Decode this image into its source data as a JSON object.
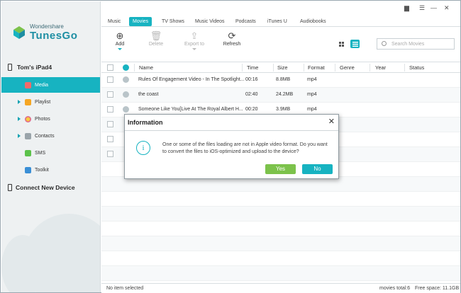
{
  "app": {
    "brand_small": "Wondershare",
    "brand_name": "TunesGo"
  },
  "sidebar": {
    "device": "Tom's iPad4",
    "items": [
      {
        "label": "Media",
        "icon": "music-icon"
      },
      {
        "label": "Playlist",
        "icon": "playlist-icon"
      },
      {
        "label": "Photos",
        "icon": "photos-icon"
      },
      {
        "label": "Contacts",
        "icon": "contacts-icon"
      },
      {
        "label": "SMS",
        "icon": "sms-icon"
      },
      {
        "label": "Toolkit",
        "icon": "toolkit-icon"
      }
    ],
    "connect": "Connect New Device"
  },
  "tabs": [
    "Music",
    "Movies",
    "TV Shows",
    "Music Videos",
    "Podcasts",
    "iTunes U",
    "Audiobooks"
  ],
  "active_tab": "Movies",
  "toolbar": {
    "add": "Add",
    "delete": "Delete",
    "export": "Export to",
    "refresh": "Refresh"
  },
  "search": {
    "placeholder": "Search Movies"
  },
  "table": {
    "headers": {
      "name": "Name",
      "time": "Time",
      "size": "Size",
      "format": "Format",
      "genre": "Genre",
      "year": "Year",
      "status": "Status"
    },
    "rows": [
      {
        "name": "Rules Of Engagement Video - In The Spotlight...",
        "time": "00:16",
        "size": "8.8MB",
        "format": "mp4"
      },
      {
        "name": "the coast",
        "time": "02:40",
        "size": "24.2MB",
        "format": "mp4"
      },
      {
        "name": "Someone Like You[Live At The Royal Albert H...",
        "time": "00:20",
        "size": "3.9MB",
        "format": "mp4"
      }
    ]
  },
  "status": {
    "selection": "No item selected",
    "count": "movies total:6",
    "space": "Free space: 11.1GB"
  },
  "dialog": {
    "title": "Information",
    "message": "One or some of the files loading are not in Apple video format. Do you want to convert the files to iOS-optimized and upload to the device?",
    "yes": "Yes",
    "no": "No",
    "icon": "i"
  },
  "colors": {
    "accent": "#17b3c1",
    "yes": "#7cc24b"
  }
}
